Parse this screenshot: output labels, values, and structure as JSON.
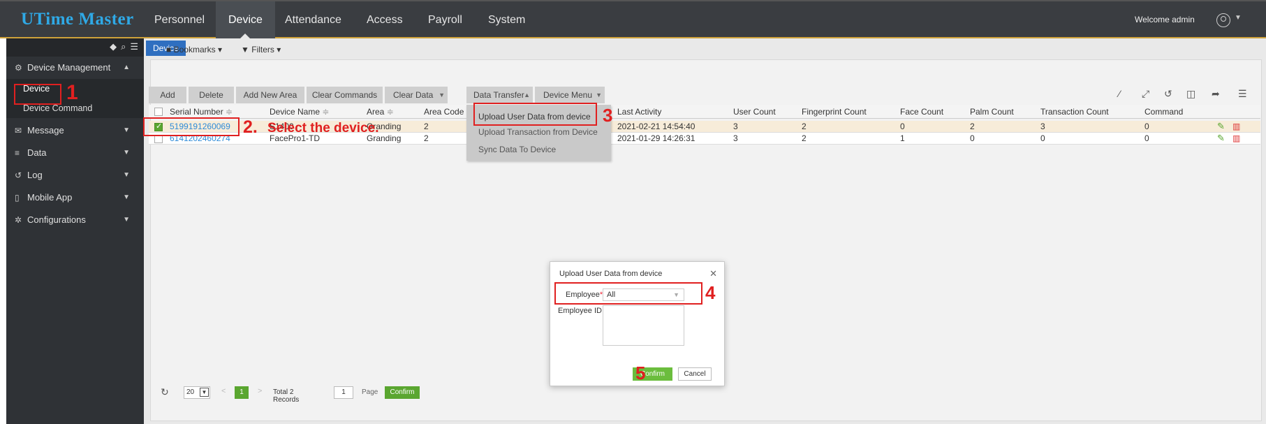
{
  "app": {
    "logo": "UTime Master"
  },
  "nav": {
    "items": [
      "Personnel",
      "Device",
      "Attendance",
      "Access",
      "Payroll",
      "System"
    ],
    "active": "Device"
  },
  "header": {
    "welcome": "Welcome admin"
  },
  "sidebar": {
    "groups": [
      {
        "label": "Device Management",
        "icon": "device-icon",
        "expanded": true
      },
      {
        "label": "Message",
        "icon": "message-icon"
      },
      {
        "label": "Data",
        "icon": "database-icon"
      },
      {
        "label": "Log",
        "icon": "log-icon"
      },
      {
        "label": "Mobile App",
        "icon": "mobile-icon"
      },
      {
        "label": "Configurations",
        "icon": "gears-icon"
      }
    ],
    "sub_items": [
      "Device",
      "Device Command"
    ]
  },
  "tab": {
    "label": "Device"
  },
  "filters": {
    "bookmarks": "Bookmarks",
    "filters": "Filters"
  },
  "toolbar": {
    "buttons": [
      "Add",
      "Delete",
      "Add New Area",
      "Clear Commands",
      "Clear Data",
      "Data Transfer",
      "Device Menu"
    ]
  },
  "table": {
    "columns": [
      "Serial Number",
      "Device Name",
      "Area",
      "Area Code",
      "Last Activity",
      "User Count",
      "Fingerprint Count",
      "Face Count",
      "Palm Count",
      "Transaction Count",
      "Command"
    ],
    "rows": [
      {
        "serial": "5199191260069",
        "device_name": "S1400",
        "area": "Granding",
        "area_code": "2",
        "last_activity": "2021-02-21 14:54:40",
        "user_count": "3",
        "fingerprint_count": "2",
        "face_count": "0",
        "palm_count": "2",
        "transaction_count": "3",
        "command": "0",
        "selected": true
      },
      {
        "serial": "6141202460274",
        "device_name": "FacePro1-TD",
        "area": "Granding",
        "area_code": "2",
        "last_activity": "2021-01-29 14:26:31",
        "user_count": "3",
        "fingerprint_count": "2",
        "face_count": "1",
        "palm_count": "0",
        "transaction_count": "0",
        "command": "0",
        "selected": false
      }
    ]
  },
  "data_transfer_menu": {
    "items": [
      "Upload User Data from device",
      "Upload Transaction from Device",
      "Sync Data To Device"
    ]
  },
  "pager": {
    "page_size": "20",
    "current_page": "1",
    "total": "Total 2 Records",
    "page_input": "1",
    "page_label": "Page",
    "confirm": "Confirm"
  },
  "dialog": {
    "title": "Upload User Data from device",
    "employee_label": "Employee",
    "employee_value": "All",
    "employee_id_label": "Employee ID",
    "confirm": "Confirm",
    "cancel": "Cancel"
  },
  "annotations": {
    "step1": "1",
    "step2": "2.",
    "step2_text": "Select the device.",
    "step3": "3",
    "step4": "4",
    "step5": "5"
  },
  "colors": {
    "topbar": "#3a3d41",
    "sidebar": "#2f3236",
    "accent_blue": "#2f6fc0",
    "link": "#2e8bd8",
    "green": "#5aa630",
    "annotation_red": "#e02020"
  }
}
